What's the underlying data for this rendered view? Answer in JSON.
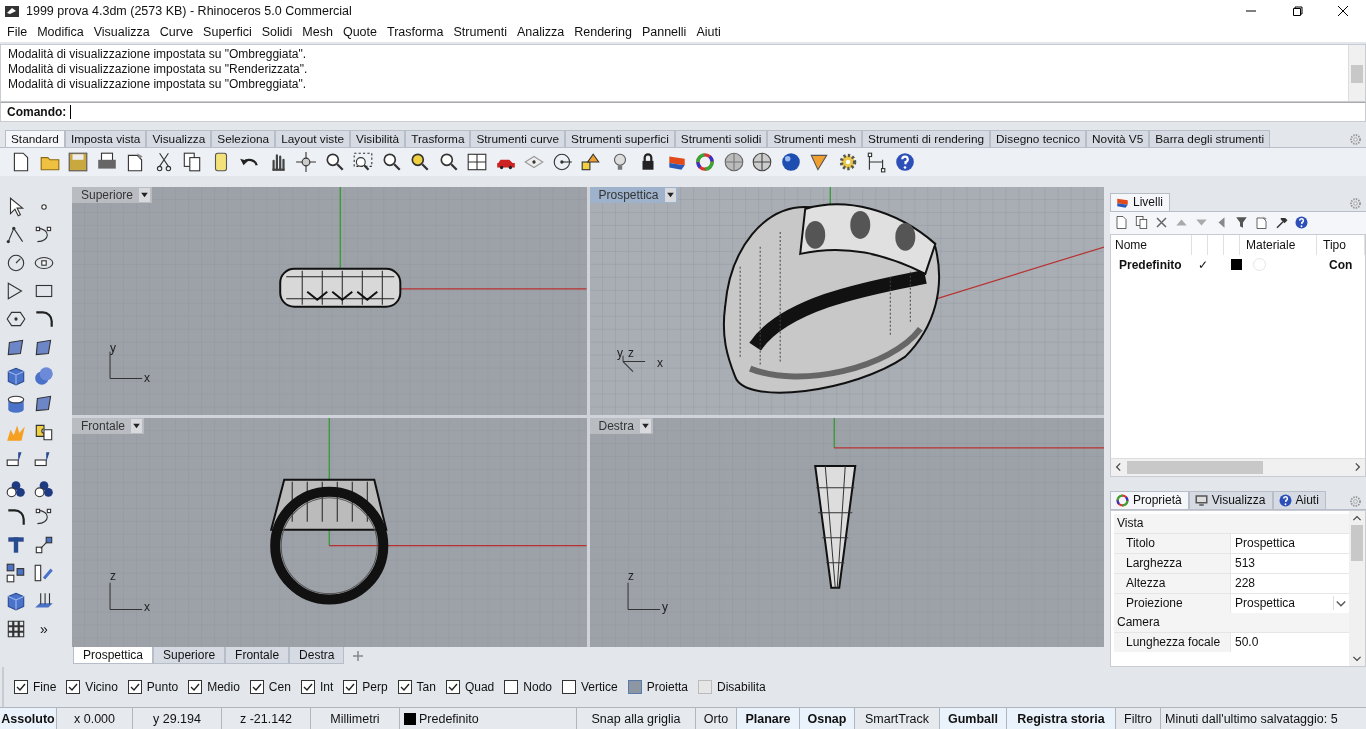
{
  "window": {
    "title": "1999 prova 4.3dm (2573 KB) - Rhinoceros 5.0 Commercial"
  },
  "menu": [
    "File",
    "Modifica",
    "Visualizza",
    "Curve",
    "Superfici",
    "Solidi",
    "Mesh",
    "Quote",
    "Trasforma",
    "Strumenti",
    "Analizza",
    "Rendering",
    "Pannelli",
    "Aiuti"
  ],
  "command_history": [
    "Modalità di visualizzazione impostata su \"Ombreggiata\".",
    "Modalità di visualizzazione impostata su \"Renderizzata\".",
    "Modalità di visualizzazione impostata su \"Ombreggiata\"."
  ],
  "command_prompt": "Comando:",
  "toolbar_tabs": [
    {
      "label": "Standard",
      "selected": true
    },
    {
      "label": "Imposta vista",
      "selected": false
    },
    {
      "label": "Visualizza",
      "selected": false
    },
    {
      "label": "Seleziona",
      "selected": false
    },
    {
      "label": "Layout viste",
      "selected": false
    },
    {
      "label": "Visibilità",
      "selected": false
    },
    {
      "label": "Trasforma",
      "selected": false
    },
    {
      "label": "Strumenti curve",
      "selected": false
    },
    {
      "label": "Strumenti superfici",
      "selected": false
    },
    {
      "label": "Strumenti solidi",
      "selected": false
    },
    {
      "label": "Strumenti mesh",
      "selected": false
    },
    {
      "label": "Strumenti di rendering",
      "selected": false
    },
    {
      "label": "Disegno tecnico",
      "selected": false
    },
    {
      "label": "Novità V5",
      "selected": false
    },
    {
      "label": "Barra degli strumenti",
      "selected": false
    }
  ],
  "more_tools": "»",
  "viewports": [
    {
      "title": "Superiore",
      "selected": false,
      "axis_labels": [
        "y",
        "x"
      ]
    },
    {
      "title": "Prospettica",
      "selected": true,
      "axis_labels": [
        "y",
        "z",
        "x"
      ]
    },
    {
      "title": "Frontale",
      "selected": false,
      "axis_labels": [
        "z",
        "x"
      ]
    },
    {
      "title": "Destra",
      "selected": false,
      "axis_labels": [
        "z",
        "y"
      ]
    }
  ],
  "viewport_tabs": [
    {
      "label": "Prospettica",
      "selected": true
    },
    {
      "label": "Superiore",
      "selected": false
    },
    {
      "label": "Frontale",
      "selected": false
    },
    {
      "label": "Destra",
      "selected": false
    }
  ],
  "layers_panel": {
    "tab": "Livelli",
    "columns": {
      "name": "Nome",
      "material": "Materiale",
      "linetype": "Tipo"
    },
    "rows": [
      {
        "name": "Predefinito",
        "visible": "✓",
        "color": "#000000",
        "linetype": "Con"
      }
    ]
  },
  "properties_panel": {
    "tabs": [
      {
        "label": "Proprietà",
        "selected": true
      },
      {
        "label": "Visualizza",
        "selected": false
      },
      {
        "label": "Aiuti",
        "selected": false
      }
    ],
    "sections": [
      {
        "title": "Vista",
        "rows": [
          {
            "label": "Titolo",
            "value": "Prospettica",
            "kind": "text"
          },
          {
            "label": "Larghezza",
            "value": "513",
            "kind": "text"
          },
          {
            "label": "Altezza",
            "value": "228",
            "kind": "text"
          },
          {
            "label": "Proiezione",
            "value": "Prospettica",
            "kind": "dropdown"
          }
        ]
      },
      {
        "title": "Camera",
        "rows": [
          {
            "label": "Lunghezza focale",
            "value": "50.0",
            "kind": "text"
          }
        ]
      }
    ]
  },
  "osnaps": [
    {
      "label": "Fine",
      "kind": "check",
      "checked": true
    },
    {
      "label": "Vicino",
      "kind": "check",
      "checked": true
    },
    {
      "label": "Punto",
      "kind": "check",
      "checked": true
    },
    {
      "label": "Medio",
      "kind": "check",
      "checked": true
    },
    {
      "label": "Cen",
      "kind": "check",
      "checked": true
    },
    {
      "label": "Int",
      "kind": "check",
      "checked": true
    },
    {
      "label": "Perp",
      "kind": "check",
      "checked": true
    },
    {
      "label": "Tan",
      "kind": "check",
      "checked": true
    },
    {
      "label": "Quad",
      "kind": "check",
      "checked": true
    },
    {
      "label": "Nodo",
      "kind": "check",
      "checked": false
    },
    {
      "label": "Vertice",
      "kind": "check",
      "checked": false
    },
    {
      "label": "Proietta",
      "kind": "toggle",
      "checked": true
    },
    {
      "label": "Disabilita",
      "kind": "toggle",
      "checked": false
    }
  ],
  "status_bar": [
    {
      "label": "Assoluto",
      "kind": "toggle",
      "on": true
    },
    {
      "label": "x 0.000",
      "kind": "text"
    },
    {
      "label": "y 29.194",
      "kind": "text"
    },
    {
      "label": "z -21.142",
      "kind": "text"
    },
    {
      "label": "Millimetri",
      "kind": "text"
    },
    {
      "label": "Predefinito",
      "kind": "layer",
      "color": "#000000"
    },
    {
      "label": "Snap alla griglia",
      "kind": "toggle",
      "on": false
    },
    {
      "label": "Orto",
      "kind": "toggle",
      "on": false
    },
    {
      "label": "Planare",
      "kind": "toggle",
      "on": true
    },
    {
      "label": "Osnap",
      "kind": "toggle",
      "on": true
    },
    {
      "label": "SmartTrack",
      "kind": "toggle",
      "on": false
    },
    {
      "label": "Gumball",
      "kind": "toggle",
      "on": true
    },
    {
      "label": "Registra storia",
      "kind": "toggle",
      "on": true
    },
    {
      "label": "Filtro",
      "kind": "toggle",
      "on": false
    },
    {
      "label": "Minuti dall'ultimo salvataggio: 5",
      "kind": "text"
    }
  ]
}
